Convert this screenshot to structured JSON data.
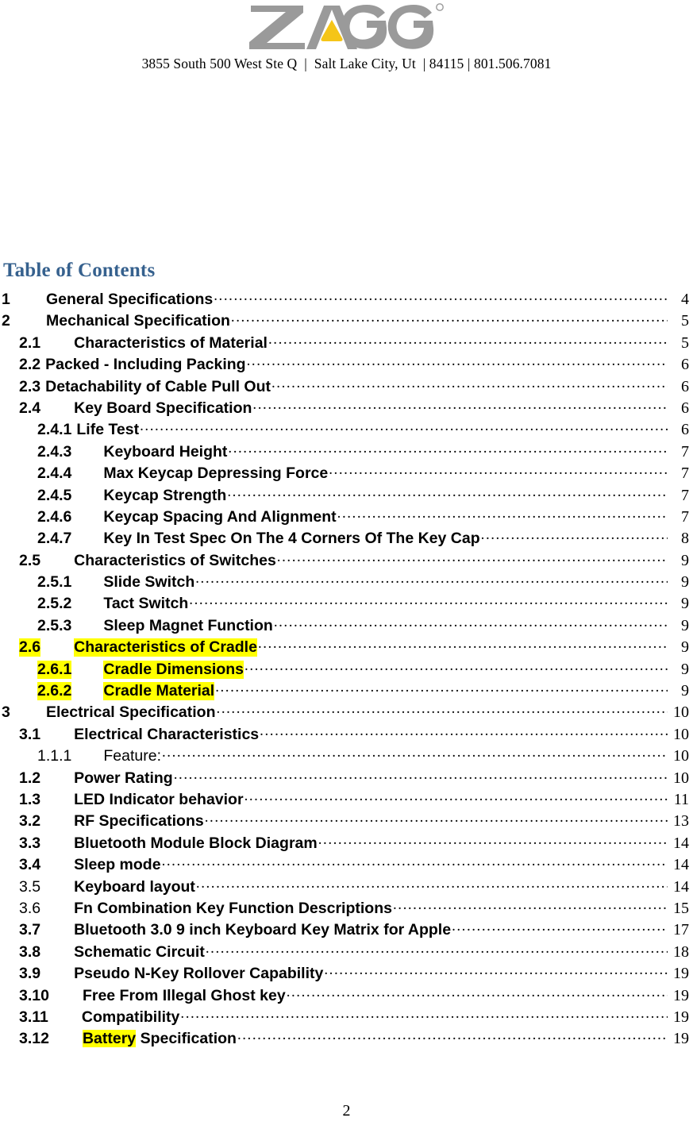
{
  "header": {
    "logo_alt": "ZAGG",
    "logo_gray": "#9A9A9A",
    "logo_accent": "#F5C518",
    "address": "3855 South 500 West Ste Q  |  Salt Lake City, Ut  | 84115 | 801.506.7081"
  },
  "toc": {
    "heading": "Table of Contents",
    "heading_color": "#36618E",
    "highlight_color": "#FFFF00",
    "entries": [
      {
        "num": "1",
        "title": "General Specifications",
        "page": "4",
        "level": 1,
        "gap": "tab",
        "highlight": "none",
        "bold_num": true,
        "bold_title": true
      },
      {
        "num": "2",
        "title": "Mechanical Specification",
        "page": "5",
        "level": 1,
        "gap": "tab",
        "highlight": "none",
        "bold_num": true,
        "bold_title": true
      },
      {
        "num": "2.1",
        "title": "Characteristics of Material",
        "page": "5",
        "level": 2,
        "gap": "tab",
        "highlight": "none",
        "bold_num": true,
        "bold_title": true
      },
      {
        "num": "2.2",
        "title": "Packed - Including Packing",
        "page": "6",
        "level": 2,
        "gap": "space",
        "highlight": "none",
        "bold_num": true,
        "bold_title": true
      },
      {
        "num": "2.3",
        "title": "Detachability of Cable Pull Out",
        "page": "6",
        "level": 2,
        "gap": "space",
        "highlight": "none",
        "bold_num": true,
        "bold_title": true
      },
      {
        "num": "2.4",
        "title": "Key Board Specification",
        "page": "6",
        "level": 2,
        "gap": "tab",
        "highlight": "none",
        "bold_num": true,
        "bold_title": true
      },
      {
        "num": "2.4.1",
        "title": "Life Test",
        "page": "6",
        "level": 3,
        "gap": "space",
        "highlight": "none",
        "bold_num": true,
        "bold_title": true
      },
      {
        "num": "2.4.3",
        "title": "Keyboard Height",
        "page": "7",
        "level": 3,
        "gap": "tab",
        "highlight": "none",
        "bold_num": true,
        "bold_title": true
      },
      {
        "num": "2.4.4",
        "title": "Max Keycap Depressing Force",
        "page": "7",
        "level": 3,
        "gap": "tab",
        "highlight": "none",
        "bold_num": true,
        "bold_title": true
      },
      {
        "num": "2.4.5",
        "title": "Keycap Strength",
        "page": "7",
        "level": 3,
        "gap": "tab",
        "highlight": "none",
        "bold_num": true,
        "bold_title": true
      },
      {
        "num": "2.4.6",
        "title": "Keycap Spacing And Alignment",
        "page": "7",
        "level": 3,
        "gap": "tab",
        "highlight": "none",
        "bold_num": true,
        "bold_title": true
      },
      {
        "num": "2.4.7",
        "title": "Key In Test Spec On The 4 Corners Of The Key Cap",
        "page": "8",
        "level": 3,
        "gap": "tab",
        "highlight": "none",
        "bold_num": true,
        "bold_title": true
      },
      {
        "num": "2.5",
        "title": "Characteristics of Switches",
        "page": "9",
        "level": 2,
        "gap": "tab",
        "highlight": "none",
        "bold_num": true,
        "bold_title": true
      },
      {
        "num": "2.5.1",
        "title": "Slide Switch",
        "page": "9",
        "level": 3,
        "gap": "tab",
        "highlight": "none",
        "bold_num": true,
        "bold_title": true
      },
      {
        "num": "2.5.2",
        "title": "Tact Switch",
        "page": "9",
        "level": 3,
        "gap": "tab",
        "highlight": "none",
        "bold_num": true,
        "bold_title": true
      },
      {
        "num": "2.5.3",
        "title": "Sleep Magnet Function",
        "page": "9",
        "level": 3,
        "gap": "tab",
        "highlight": "none",
        "bold_num": true,
        "bold_title": true
      },
      {
        "num": "2.6",
        "title": "Characteristics of Cradle",
        "page": "9",
        "level": 2,
        "gap": "tab",
        "highlight": "full",
        "bold_num": true,
        "bold_title": true
      },
      {
        "num": "2.6.1",
        "title": "Cradle Dimensions",
        "page": "9",
        "level": 3,
        "gap": "tab",
        "highlight": "full",
        "bold_num": true,
        "bold_title": true
      },
      {
        "num": "2.6.2",
        "title": "Cradle Material",
        "page": "9",
        "level": 3,
        "gap": "tab",
        "highlight": "full",
        "bold_num": true,
        "bold_title": true
      },
      {
        "num": "3",
        "title": "Electrical Specification",
        "page": "10",
        "level": 1,
        "gap": "tab",
        "highlight": "none",
        "bold_num": true,
        "bold_title": true
      },
      {
        "num": "3.1",
        "title": "Electrical Characteristics",
        "page": "10",
        "level": 2,
        "gap": "tab",
        "highlight": "none",
        "bold_num": true,
        "bold_title": true
      },
      {
        "num": "1.1.1",
        "title": "Feature:",
        "page": "10",
        "level": 3,
        "gap": "tab",
        "highlight": "none",
        "bold_num": false,
        "bold_title": false
      },
      {
        "num": "1.2",
        "title": "Power Rating",
        "page": "10",
        "level": 2,
        "gap": "tab",
        "highlight": "none",
        "bold_num": true,
        "bold_title": true
      },
      {
        "num": "1.3",
        "title": "LED Indicator behavior",
        "page": "11",
        "level": 2,
        "gap": "tab",
        "highlight": "none",
        "bold_num": true,
        "bold_title": true
      },
      {
        "num": "3.2",
        "title": "RF Specifications",
        "page": "13",
        "level": 2,
        "gap": "tab",
        "highlight": "none",
        "bold_num": true,
        "bold_title": true
      },
      {
        "num": "3.3",
        "title": "Bluetooth Module Block Diagram",
        "page": "14",
        "level": 2,
        "gap": "tab",
        "highlight": "none",
        "bold_num": true,
        "bold_title": true
      },
      {
        "num": "3.4",
        "title": "Sleep mode",
        "page": "14",
        "level": 2,
        "gap": "tab",
        "highlight": "none",
        "bold_num": true,
        "bold_title": true
      },
      {
        "num": "3.5",
        "title": "Keyboard layout",
        "page": "14",
        "level": 2,
        "gap": "tab",
        "highlight": "none",
        "bold_num": false,
        "bold_title": true
      },
      {
        "num": "3.6",
        "title": "Fn Combination Key Function Descriptions",
        "page": "15",
        "level": 2,
        "gap": "tab",
        "highlight": "none",
        "bold_num": false,
        "bold_title": true
      },
      {
        "num": "3.7",
        "title": "Bluetooth 3.0 9 inch Keyboard Key Matrix for Apple",
        "page": "17",
        "level": 2,
        "gap": "tab",
        "highlight": "none",
        "bold_num": true,
        "bold_title": true
      },
      {
        "num": "3.8",
        "title": "Schematic Circuit",
        "page": "18",
        "level": 2,
        "gap": "tab",
        "highlight": "none",
        "bold_num": true,
        "bold_title": true
      },
      {
        "num": "3.9",
        "title": "Pseudo N-Key Rollover Capability",
        "page": "19",
        "level": 2,
        "gap": "tab",
        "highlight": "none",
        "bold_num": true,
        "bold_title": true
      },
      {
        "num": "3.10",
        "title": "Free From Illegal Ghost key",
        "page": "19",
        "level": 2,
        "gap": "tab",
        "highlight": "none",
        "bold_num": true,
        "bold_title": true
      },
      {
        "num": "3.11",
        "title": "Compatibility",
        "page": "19",
        "level": 2,
        "gap": "tab",
        "highlight": "none",
        "bold_num": true,
        "bold_title": true
      },
      {
        "num": "3.12",
        "title": "Battery Specification",
        "page": "19",
        "level": 2,
        "gap": "tab",
        "highlight": "word",
        "highlight_word": "Battery",
        "bold_num": true,
        "bold_title": true
      }
    ]
  },
  "footer": {
    "page_number": "2"
  }
}
